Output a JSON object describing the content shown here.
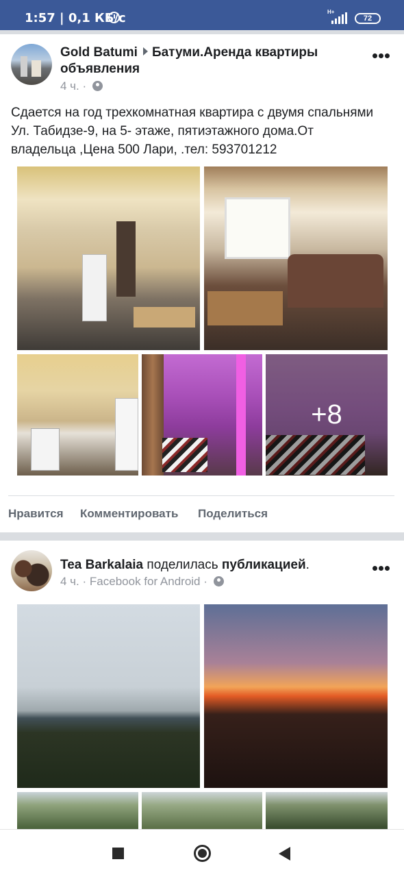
{
  "status_bar": {
    "time": "1:57",
    "speed": "0,1 КБ/с",
    "network_type": "H+",
    "battery": "72",
    "icons": [
      "alarm-icon",
      "signal-icon",
      "battery-icon"
    ]
  },
  "posts": [
    {
      "author": "Gold Batumi",
      "group": "Батуми.Аренда квартиры объявления",
      "time": "4 ч.",
      "dot": "·",
      "privacy_icon": "globe-icon",
      "text": "Сдается на год трехкомнатная квартира с двумя спальнями Ул. Табидзе-9, на 5- этаже, пятиэтажного дома.От владельца ,Цена 500 Лари, .тел: 593701212",
      "photos": [
        "kitchen",
        "living-room",
        "kitchen-2",
        "bedroom-purple",
        "bedroom-2"
      ],
      "more_photos": "+8",
      "actions": {
        "like": "Нравится",
        "comment": "Комментировать",
        "share": "Поделиться"
      }
    },
    {
      "author": "Tea Barkalaia",
      "shared_text": "поделилась",
      "shared_object": "публикацией",
      "period": ".",
      "time": "4 ч.",
      "dot": "·",
      "source": "Facebook for Android",
      "privacy_icon": "globe-icon",
      "photos": [
        "city-view",
        "sunset",
        "trees-1",
        "trees-2",
        "trees-3"
      ]
    }
  ],
  "nav": {
    "icons": [
      "recents-square-icon",
      "home-circle-icon",
      "back-triangle-icon"
    ]
  },
  "colors": {
    "brand": "#3b5998",
    "text": "#1c1e21",
    "secondary": "#606770",
    "meta": "#90949c",
    "divider": "#dadde1"
  }
}
